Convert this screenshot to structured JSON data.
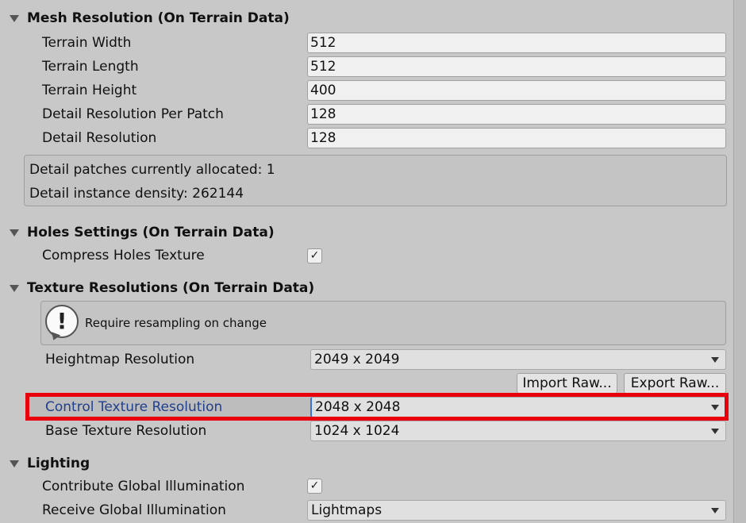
{
  "sections": {
    "mesh": {
      "title": "Mesh Resolution (On Terrain Data)",
      "fields": [
        {
          "label": "Terrain Width",
          "value": "512"
        },
        {
          "label": "Terrain Length",
          "value": "512"
        },
        {
          "label": "Terrain Height",
          "value": "400"
        },
        {
          "label": "Detail Resolution Per Patch",
          "value": "128"
        },
        {
          "label": "Detail Resolution",
          "value": "128"
        }
      ],
      "info": [
        "Detail patches currently allocated: 1",
        "Detail instance density: 262144"
      ]
    },
    "holes": {
      "title": "Holes Settings (On Terrain Data)",
      "compress_label": "Compress Holes Texture",
      "compress_checked": "✓"
    },
    "texture": {
      "title": "Texture Resolutions (On Terrain Data)",
      "help_text": "Require resampling on change",
      "heightmap_label": "Heightmap Resolution",
      "heightmap_value": "2049 x 2049",
      "import_raw": "Import Raw...",
      "export_raw": "Export Raw...",
      "control_label": "Control Texture Resolution",
      "control_value": "2048 x 2048",
      "base_label": "Base Texture Resolution",
      "base_value": "1024 x 1024"
    },
    "lighting": {
      "title": "Lighting",
      "contribute_label": "Contribute Global Illumination",
      "contribute_checked": "✓",
      "receive_label": "Receive Global Illumination",
      "receive_value": "Lightmaps"
    }
  },
  "colors": {
    "highlight": "#e8000d",
    "focus_label": "#1f3f8f"
  },
  "icons": {
    "help": "exclamation-speech-bubble-icon",
    "foldout": "triangle-down-icon",
    "check": "checkmark-icon",
    "dropdown": "triangle-down-icon"
  }
}
